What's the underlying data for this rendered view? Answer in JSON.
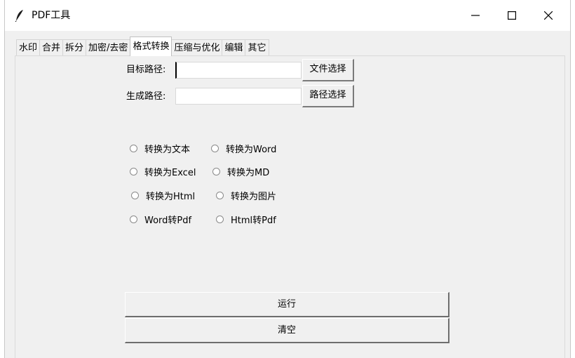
{
  "window": {
    "title": "PDF工具"
  },
  "tabs": [
    {
      "label": "水印"
    },
    {
      "label": "合并"
    },
    {
      "label": "拆分"
    },
    {
      "label": "加密/去密"
    },
    {
      "label": "格式转换",
      "active": true
    },
    {
      "label": "压缩与优化"
    },
    {
      "label": "编辑"
    },
    {
      "label": "其它"
    }
  ],
  "form": {
    "target_path_label": "目标路径:",
    "target_path_value": "",
    "file_select_label": "文件选择",
    "output_path_label": "生成路径:",
    "output_path_value": "",
    "path_select_label": "路径选择"
  },
  "options": [
    {
      "label": "转换为文本",
      "selected": false
    },
    {
      "label": "转换为Word",
      "selected": false
    },
    {
      "label": "转换为Excel",
      "selected": false
    },
    {
      "label": "转换为MD",
      "selected": false
    },
    {
      "label": "转换为Html",
      "selected": false
    },
    {
      "label": "转换为图片",
      "selected": false
    },
    {
      "label": "Word转Pdf",
      "selected": false
    },
    {
      "label": "Html转Pdf",
      "selected": false
    }
  ],
  "actions": {
    "run_label": "运行",
    "clear_label": "清空"
  },
  "icons": {
    "app": "feather-icon",
    "minimize": "minimize-icon",
    "maximize": "maximize-icon",
    "close": "close-icon"
  }
}
